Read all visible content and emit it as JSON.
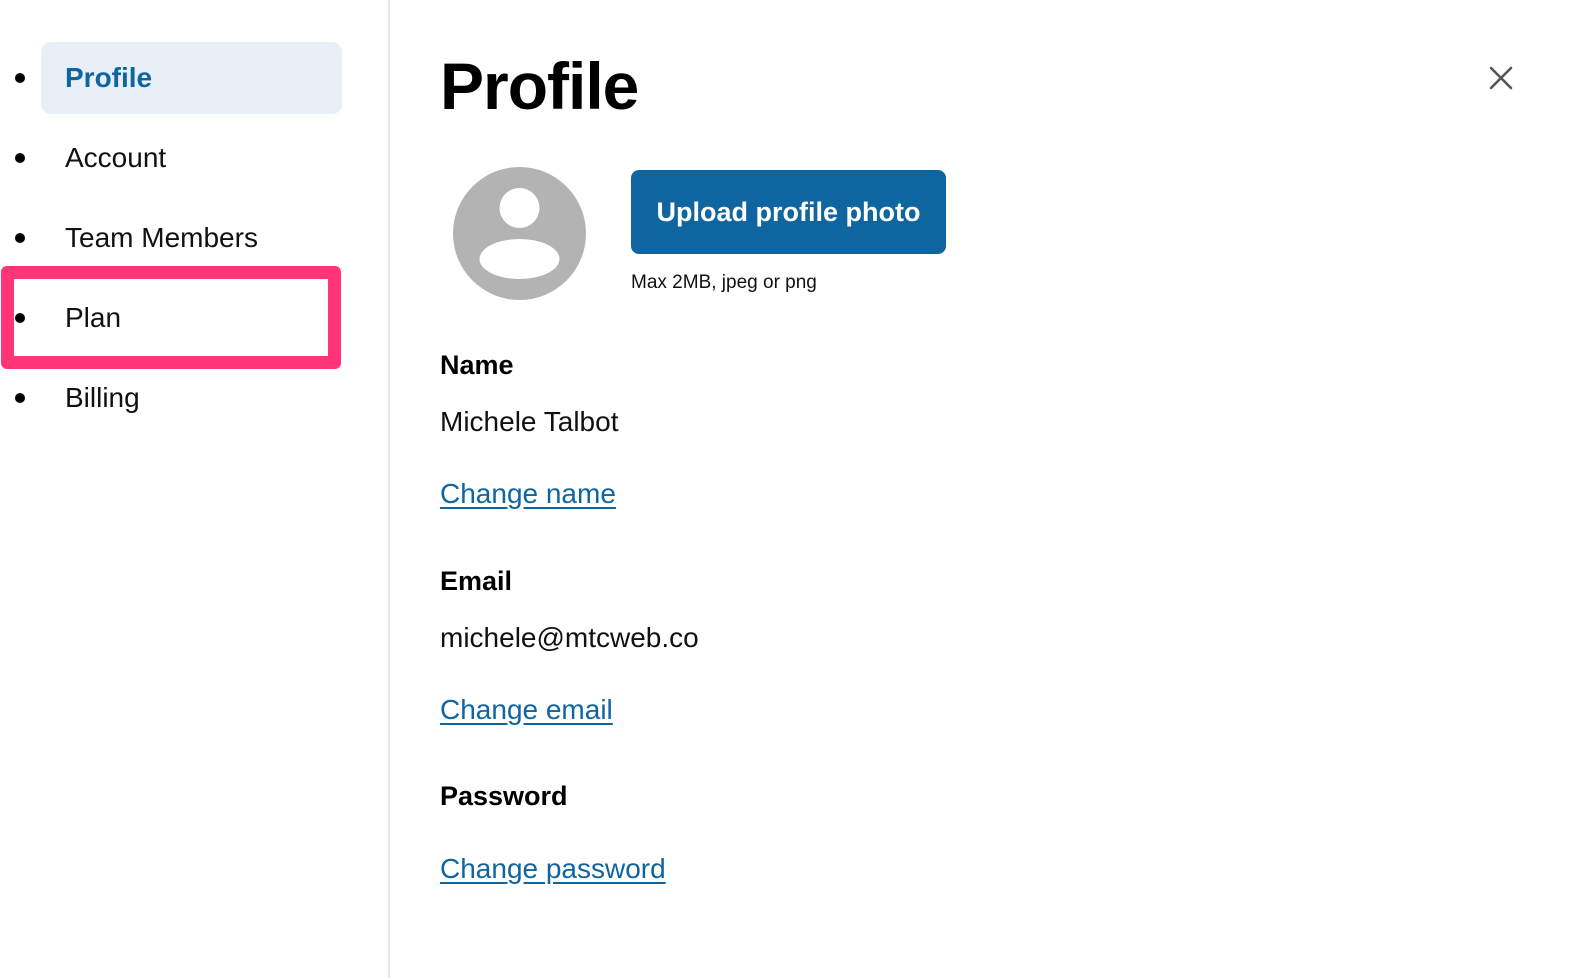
{
  "sidebar": {
    "items": [
      {
        "label": "Profile",
        "active": true
      },
      {
        "label": "Account",
        "active": false
      },
      {
        "label": "Team Members",
        "active": false
      },
      {
        "label": "Plan",
        "active": false,
        "highlighted": true
      },
      {
        "label": "Billing",
        "active": false
      }
    ]
  },
  "main": {
    "title": "Profile",
    "close_icon": "close-icon",
    "avatar_icon": "user-avatar-icon",
    "upload_button_label": "Upload profile photo",
    "upload_hint": "Max 2MB, jpeg or png",
    "name": {
      "label": "Name",
      "value": "Michele Talbot",
      "link": "Change name"
    },
    "email": {
      "label": "Email",
      "value": "michele@mtcweb.co",
      "link": "Change email"
    },
    "password": {
      "label": "Password",
      "link": "Change password"
    }
  },
  "colors": {
    "accent": "#0f659f",
    "active_bg": "#e8eff7",
    "highlight": "#ff3577",
    "avatar": "#b3b3b3"
  }
}
